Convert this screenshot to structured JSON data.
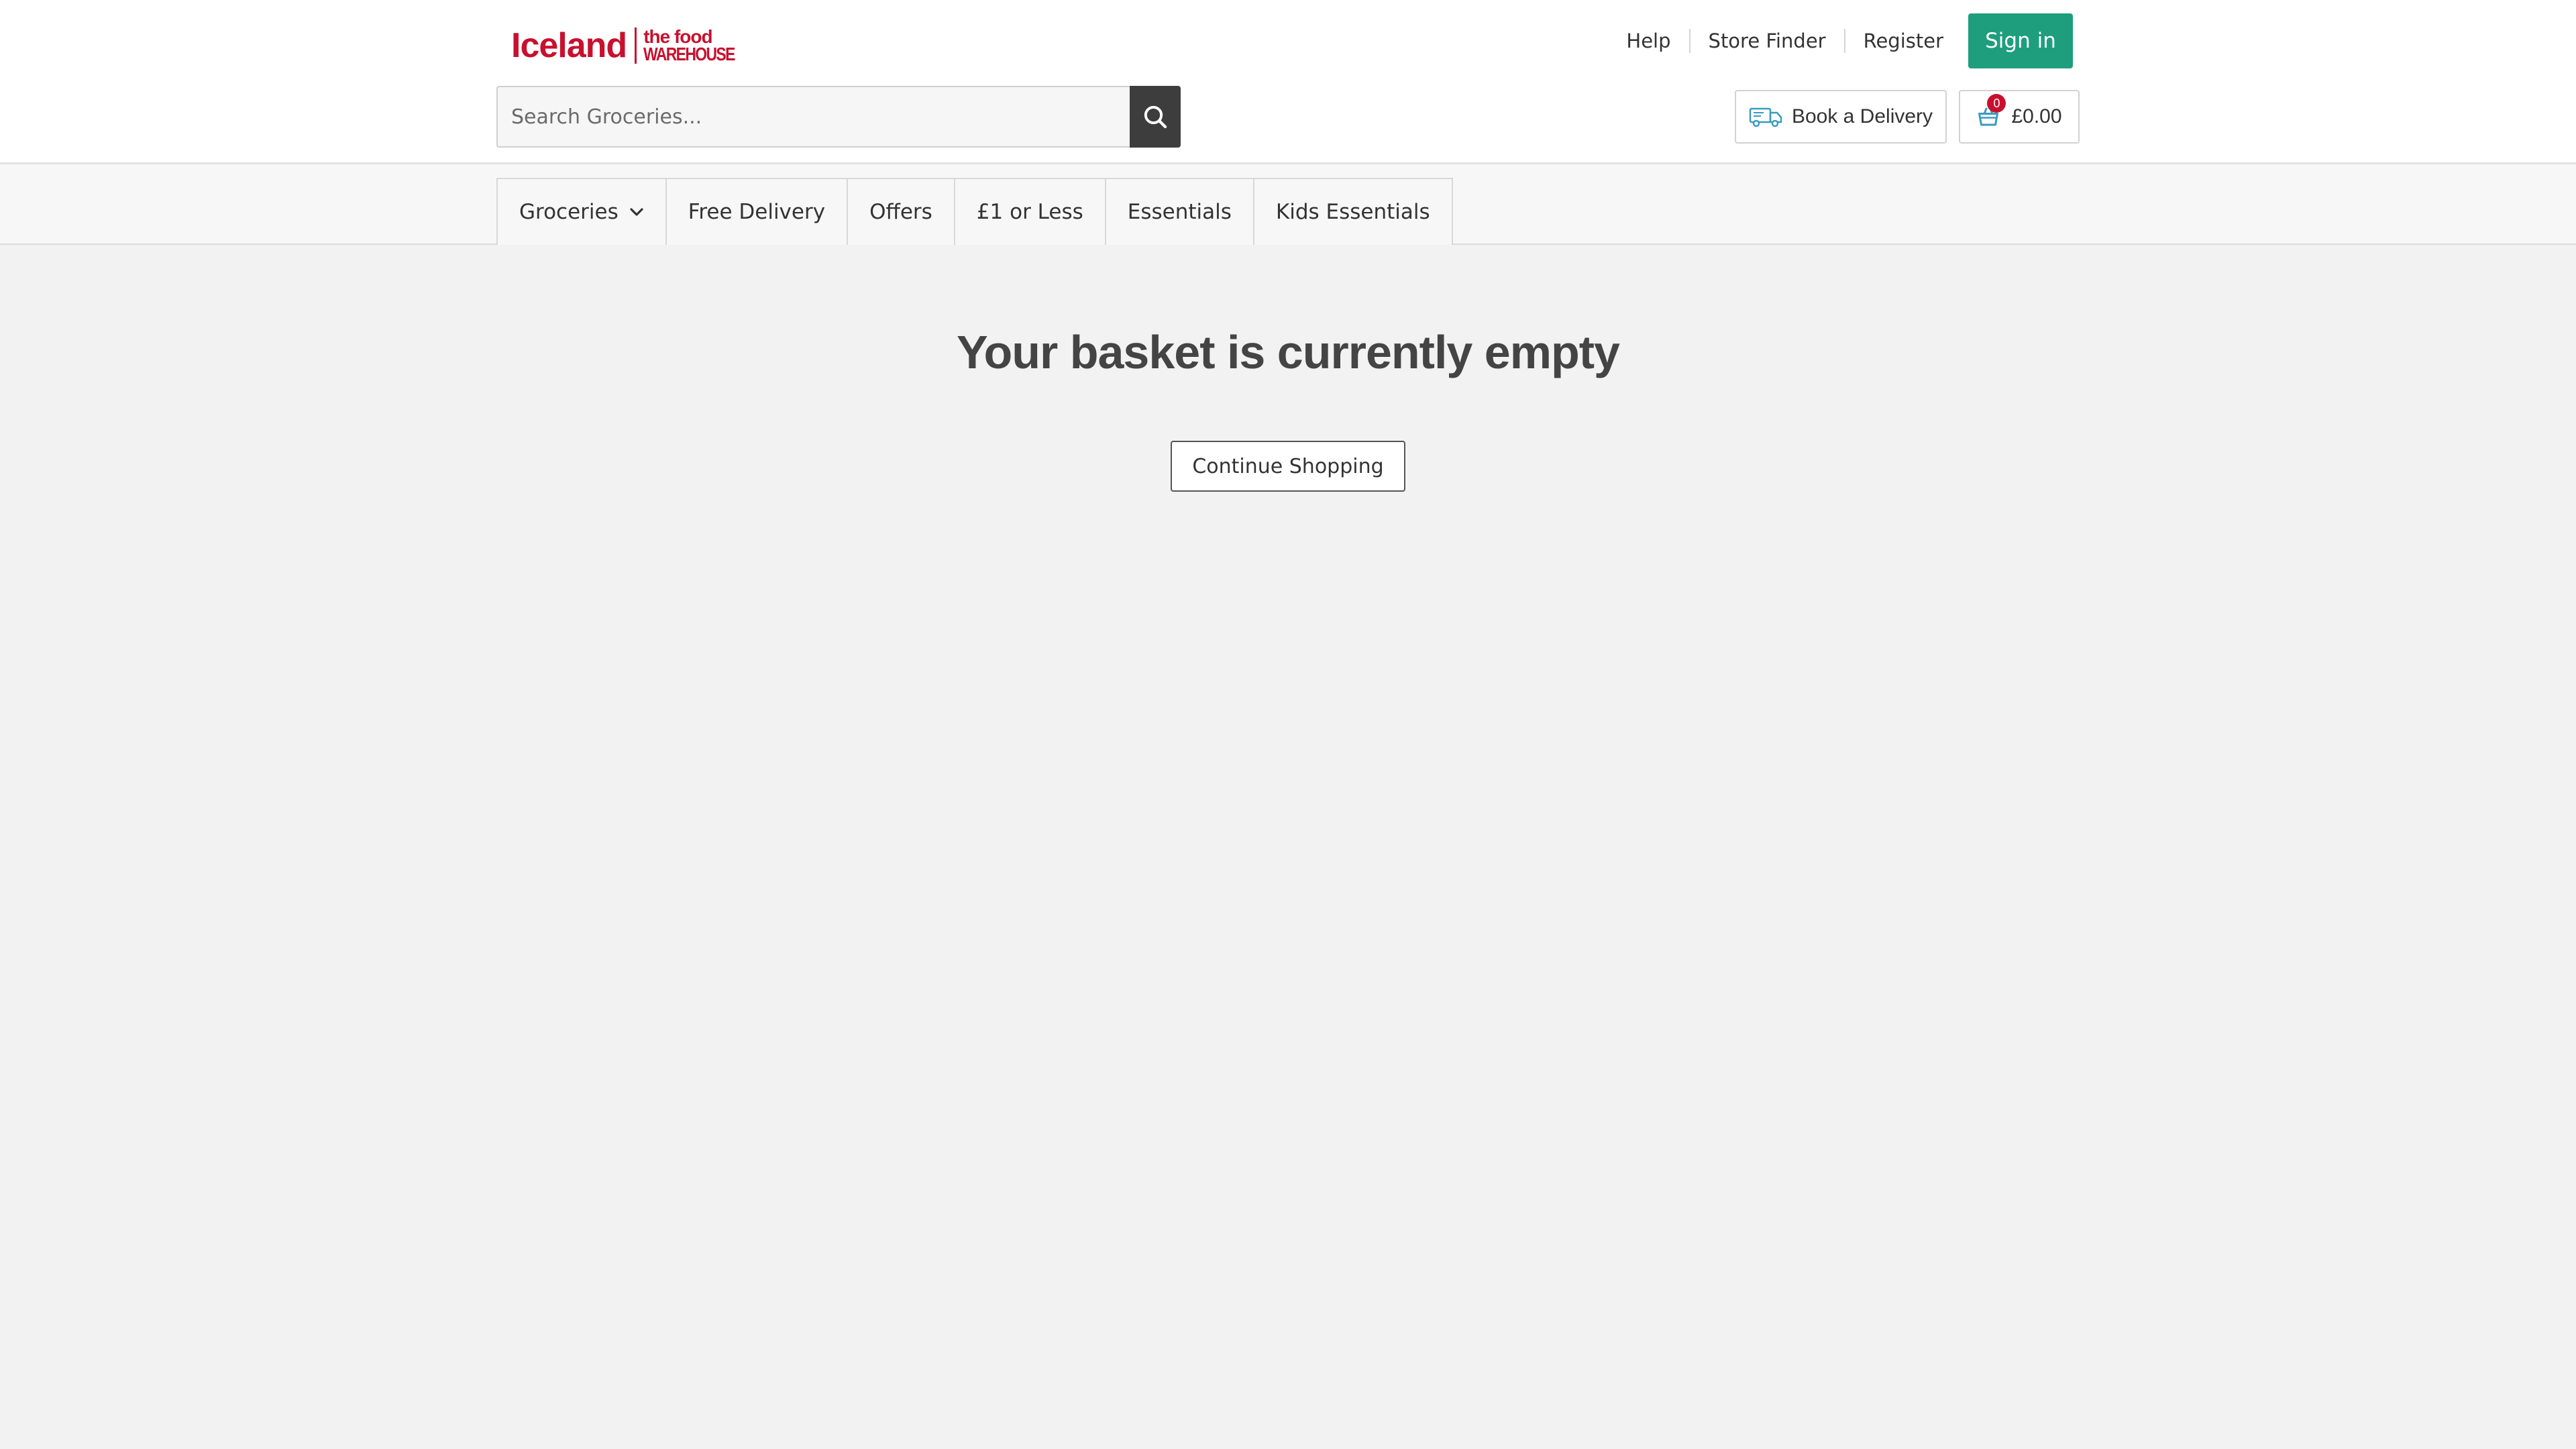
{
  "header": {
    "logo": {
      "brand": "Iceland",
      "sub_top": "the food",
      "sub_bottom": "WAREHOUSE"
    },
    "links": [
      {
        "label": "Help"
      },
      {
        "label": "Store Finder"
      },
      {
        "label": "Register"
      }
    ],
    "signin_label": "Sign in",
    "search": {
      "placeholder": "Search Groceries...",
      "value": ""
    },
    "delivery_label": "Book a Delivery",
    "basket": {
      "count": "0",
      "total": "£0.00"
    }
  },
  "nav": {
    "items": [
      {
        "label": "Groceries"
      },
      {
        "label": "Free Delivery"
      },
      {
        "label": "Offers"
      },
      {
        "label": "£1 or Less"
      },
      {
        "label": "Essentials"
      },
      {
        "label": "Kids Essentials"
      }
    ]
  },
  "main": {
    "title": "Your basket is currently empty",
    "continue_label": "Continue Shopping"
  },
  "colors": {
    "brand_red": "#c8102e",
    "signin_green": "#1f9e7e",
    "page_bg": "#f2f2f2"
  },
  "icons": [
    "search-icon",
    "delivery-van-icon",
    "basket-icon",
    "chevron-down-icon"
  ]
}
